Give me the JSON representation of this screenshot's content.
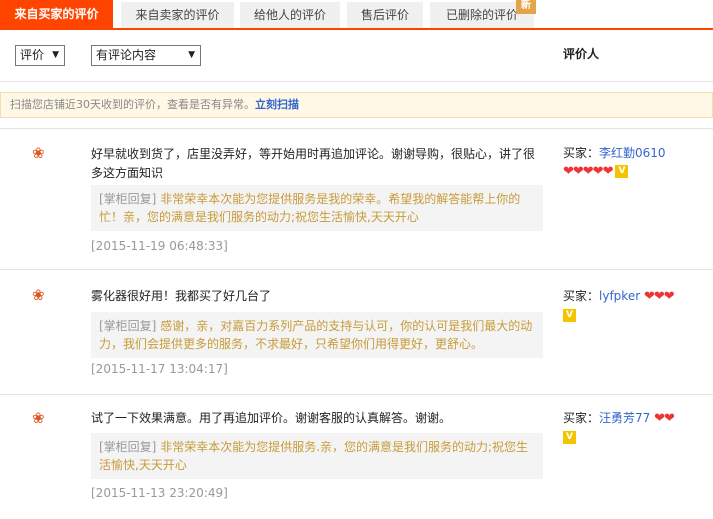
{
  "tabs": [
    {
      "label": "来自买家的评价",
      "active": true
    },
    {
      "label": "来自卖家的评价",
      "active": false
    },
    {
      "label": "给他人的评价",
      "active": false
    },
    {
      "label": "售后评价",
      "active": false
    },
    {
      "label": "已删除的评价",
      "active": false
    }
  ],
  "new_badge": "新",
  "filters": {
    "rating_select": "评价",
    "content_select": "有评论内容"
  },
  "reviewer_header": "评价人",
  "notice": {
    "text": "扫描您店铺近30天收到的评价，查看是否有异常。",
    "link": "立刻扫描"
  },
  "reviews": [
    {
      "content": "好早就收到货了，店里没弄好，等开始用时再追加评论。谢谢导购，很贴心，讲了很多这方面知识",
      "reply_tag": "[掌柜回复]",
      "reply": " 非常荣幸本次能为您提供服务是我的荣幸。希望我的解答能帮上你的忙！亲，您的满意是我们服务的动力;祝您生活愉快,天天开心",
      "date": "[2015-11-19 06:48:33]",
      "buyer_label": "买家：",
      "buyer_name": "李红勤0610",
      "hearts": "❤❤❤❤❤",
      "vip": "V"
    },
    {
      "content": "雾化器很好用！我都买了好几台了",
      "reply_tag": "[掌柜回复]",
      "reply": " 感谢，亲，对嘉百力系列产品的支持与认可，你的认可是我们最大的动力，我们会提供更多的服务，不求最好，只希望你们用得更好，更舒心。",
      "date": "[2015-11-17 13:04:17]",
      "buyer_label": "买家：",
      "buyer_name": "lyfpker",
      "hearts": "❤❤❤",
      "vip": "V"
    },
    {
      "content": "试了一下效果满意。用了再追加评价。谢谢客服的认真解答。谢谢。",
      "reply_tag": "[掌柜回复]",
      "reply": " 非常荣幸本次能为您提供服务.亲，您的满意是我们服务的动力;祝您生活愉快,天天开心",
      "date": "[2015-11-13 23:20:49]",
      "buyer_label": "买家：",
      "buyer_name": "汪勇芳77",
      "hearts": "❤❤",
      "vip": "V"
    }
  ],
  "colors": {
    "accent": "#ff4400",
    "link": "#3366cc",
    "reply_text": "#c79b3a"
  },
  "icons": {
    "flower": "flower-icon",
    "heart": "heart-icon",
    "vip": "vip-badge-icon",
    "dropdown": "chevron-down-icon"
  }
}
